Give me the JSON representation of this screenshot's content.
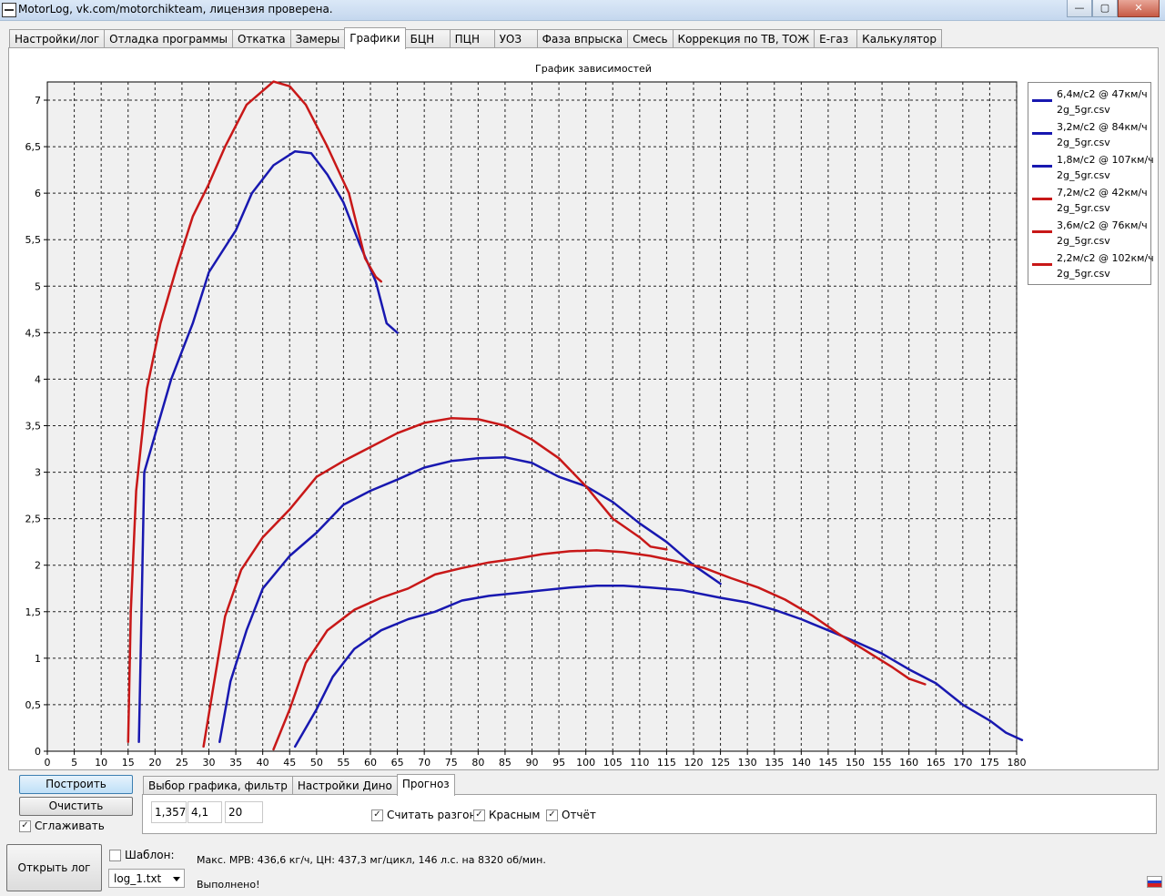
{
  "window": {
    "title": "MotorLog, vk.com/motorchikteam, лицензия проверена.",
    "buttons": [
      "—",
      "▢",
      "✕"
    ]
  },
  "tabs": [
    {
      "label": "Настройки/лог"
    },
    {
      "label": "Отладка программы"
    },
    {
      "label": "Откатка"
    },
    {
      "label": "Замеры"
    },
    {
      "label": "Графики",
      "active": true
    },
    {
      "label": "БЦН"
    },
    {
      "label": "ПЦН"
    },
    {
      "label": "УОЗ"
    },
    {
      "label": "Фаза впрыска"
    },
    {
      "label": "Смесь"
    },
    {
      "label": "Коррекция по ТВ, ТОЖ"
    },
    {
      "label": "E-газ"
    },
    {
      "label": "Калькулятор"
    }
  ],
  "chart_data": {
    "type": "line",
    "title": "График зависимостей",
    "xlabel": "",
    "ylabel": "",
    "xlim": [
      0,
      180
    ],
    "ylim": [
      0,
      7.2
    ],
    "x_ticks": [
      0,
      5,
      10,
      15,
      20,
      25,
      30,
      35,
      40,
      45,
      50,
      55,
      60,
      65,
      70,
      75,
      80,
      85,
      90,
      95,
      100,
      105,
      110,
      115,
      120,
      125,
      130,
      135,
      140,
      145,
      150,
      155,
      160,
      165,
      170,
      175,
      180
    ],
    "y_ticks": [
      "0",
      "0,5",
      "1",
      "1,5",
      "2",
      "2,5",
      "3",
      "3,5",
      "4",
      "4,5",
      "5",
      "5,5",
      "6",
      "6,5",
      "7"
    ],
    "grid": true,
    "legend_position": "right",
    "series": [
      {
        "name": "6,4м/с2 @ 47км/ч 2g_5gr.csv",
        "color": "#1818b0",
        "points": [
          [
            17,
            0.1
          ],
          [
            17.5,
            1.5
          ],
          [
            18,
            3
          ],
          [
            20,
            3.4
          ],
          [
            23,
            4
          ],
          [
            27,
            4.6
          ],
          [
            30,
            5.15
          ],
          [
            35,
            5.6
          ],
          [
            38,
            6
          ],
          [
            42,
            6.3
          ],
          [
            46,
            6.45
          ],
          [
            49,
            6.43
          ],
          [
            52,
            6.2
          ],
          [
            55,
            5.9
          ],
          [
            58,
            5.45
          ],
          [
            61,
            5.05
          ],
          [
            63,
            4.6
          ],
          [
            65,
            4.5
          ]
        ]
      },
      {
        "name": "3,2м/с2 @ 84км/ч 2g_5gr.csv",
        "color": "#1818b0",
        "points": [
          [
            32,
            0.1
          ],
          [
            34,
            0.75
          ],
          [
            37,
            1.3
          ],
          [
            40,
            1.75
          ],
          [
            45,
            2.1
          ],
          [
            50,
            2.35
          ],
          [
            55,
            2.65
          ],
          [
            60,
            2.8
          ],
          [
            65,
            2.92
          ],
          [
            70,
            3.05
          ],
          [
            75,
            3.12
          ],
          [
            80,
            3.15
          ],
          [
            85,
            3.16
          ],
          [
            90,
            3.1
          ],
          [
            95,
            2.95
          ],
          [
            100,
            2.85
          ],
          [
            105,
            2.68
          ],
          [
            110,
            2.45
          ],
          [
            115,
            2.25
          ],
          [
            120,
            2
          ],
          [
            125,
            1.8
          ]
        ]
      },
      {
        "name": "1,8м/с2 @ 107км/ч 2g_5gr.csv",
        "color": "#1818b0",
        "points": [
          [
            46,
            0.05
          ],
          [
            50,
            0.45
          ],
          [
            53,
            0.8
          ],
          [
            57,
            1.1
          ],
          [
            62,
            1.3
          ],
          [
            67,
            1.42
          ],
          [
            72,
            1.5
          ],
          [
            77,
            1.62
          ],
          [
            82,
            1.67
          ],
          [
            87,
            1.7
          ],
          [
            92,
            1.73
          ],
          [
            97,
            1.76
          ],
          [
            102,
            1.78
          ],
          [
            107,
            1.78
          ],
          [
            112,
            1.76
          ],
          [
            118,
            1.73
          ],
          [
            125,
            1.65
          ],
          [
            130,
            1.6
          ],
          [
            135,
            1.52
          ],
          [
            140,
            1.42
          ],
          [
            145,
            1.3
          ],
          [
            150,
            1.18
          ],
          [
            155,
            1.05
          ],
          [
            160,
            0.88
          ],
          [
            165,
            0.73
          ],
          [
            170,
            0.5
          ],
          [
            175,
            0.33
          ],
          [
            178,
            0.2
          ],
          [
            181,
            0.12
          ]
        ]
      },
      {
        "name": "7,2м/с2 @ 42км/ч 2g_5gr.csv",
        "color": "#c81818",
        "points": [
          [
            15,
            0.1
          ],
          [
            15.5,
            1.5
          ],
          [
            16.5,
            2.8
          ],
          [
            18.5,
            3.9
          ],
          [
            21,
            4.6
          ],
          [
            24,
            5.2
          ],
          [
            27,
            5.75
          ],
          [
            30,
            6.1
          ],
          [
            33,
            6.5
          ],
          [
            37,
            6.95
          ],
          [
            42,
            7.2
          ],
          [
            45,
            7.15
          ],
          [
            48,
            6.95
          ],
          [
            52,
            6.5
          ],
          [
            56,
            6
          ],
          [
            59,
            5.3
          ],
          [
            61,
            5.1
          ],
          [
            62,
            5.05
          ]
        ]
      },
      {
        "name": "3,6м/с2 @ 76км/ч 2g_5gr.csv",
        "color": "#c81818",
        "points": [
          [
            29,
            0.05
          ],
          [
            31,
            0.75
          ],
          [
            33,
            1.45
          ],
          [
            36,
            1.95
          ],
          [
            40,
            2.3
          ],
          [
            45,
            2.6
          ],
          [
            50,
            2.95
          ],
          [
            55,
            3.12
          ],
          [
            60,
            3.27
          ],
          [
            65,
            3.42
          ],
          [
            70,
            3.53
          ],
          [
            75,
            3.58
          ],
          [
            80,
            3.57
          ],
          [
            85,
            3.5
          ],
          [
            90,
            3.35
          ],
          [
            95,
            3.15
          ],
          [
            100,
            2.85
          ],
          [
            105,
            2.5
          ],
          [
            110,
            2.3
          ],
          [
            112,
            2.2
          ],
          [
            115,
            2.17
          ]
        ]
      },
      {
        "name": "2,2м/с2 @ 102км/ч 2g_5gr.csv",
        "color": "#c81818",
        "points": [
          [
            42,
            0.02
          ],
          [
            45,
            0.45
          ],
          [
            48,
            0.95
          ],
          [
            52,
            1.3
          ],
          [
            57,
            1.52
          ],
          [
            62,
            1.65
          ],
          [
            67,
            1.75
          ],
          [
            72,
            1.9
          ],
          [
            77,
            1.97
          ],
          [
            82,
            2.03
          ],
          [
            87,
            2.07
          ],
          [
            92,
            2.12
          ],
          [
            97,
            2.15
          ],
          [
            102,
            2.16
          ],
          [
            107,
            2.14
          ],
          [
            112,
            2.1
          ],
          [
            117,
            2.04
          ],
          [
            122,
            1.97
          ],
          [
            127,
            1.86
          ],
          [
            132,
            1.76
          ],
          [
            137,
            1.63
          ],
          [
            142,
            1.46
          ],
          [
            147,
            1.26
          ],
          [
            152,
            1.08
          ],
          [
            157,
            0.9
          ],
          [
            160,
            0.78
          ],
          [
            163,
            0.72
          ]
        ]
      }
    ]
  },
  "buttons": {
    "build": "Построить",
    "clear": "Очистить",
    "open_log": "Открыть лог"
  },
  "smooth": {
    "label": "Сглаживать",
    "checked": true
  },
  "subtabs": [
    {
      "label": "Выбор графика, фильтр"
    },
    {
      "label": "Настройки Дино"
    },
    {
      "label": "Прогноз",
      "active": true
    }
  ],
  "forecast": {
    "field1": "1,357",
    "field2": "4,1",
    "field3": "20",
    "count_accel": {
      "label": "Считать разгон",
      "checked": true
    },
    "red": {
      "label": "Красным",
      "checked": true
    },
    "report": {
      "label": "Отчёт",
      "checked": true
    }
  },
  "template": {
    "label": "Шаблон:",
    "checked": false,
    "select_value": "log_1.txt"
  },
  "status": {
    "line1": "Макс. МРВ: 436,6 кг/ч, ЦН: 437,3 мг/цикл, 146 л.с. на 8320 об/мин.",
    "line2": "Выполнено!"
  }
}
